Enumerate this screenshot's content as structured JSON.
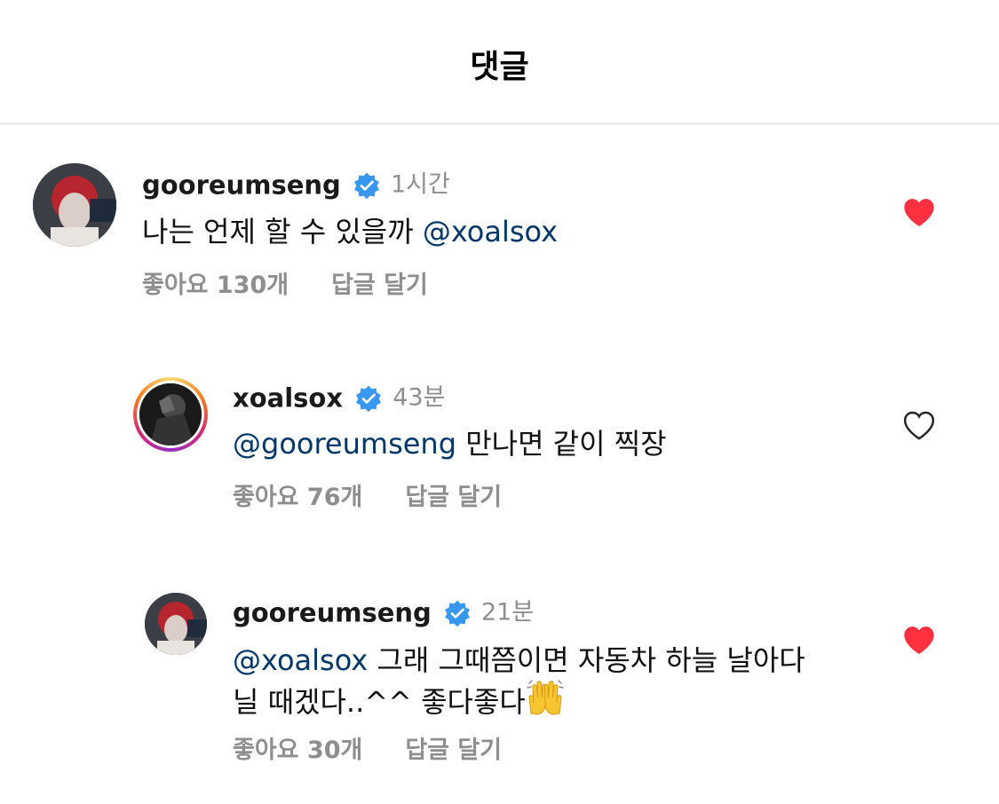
{
  "header": {
    "title": "댓글"
  },
  "comments": [
    {
      "username": "gooreumseng",
      "time": "1시간",
      "text": "나는 언제 할 수 있을까",
      "mention": "@xoalsox",
      "likes": "좋아요 130개",
      "reply": "답글 달기",
      "liked": true
    },
    {
      "username": "xoalsox",
      "time": "43분",
      "mention": "@gooreumseng",
      "text": "만나면 같이 찍장",
      "likes": "좋아요 76개",
      "reply": "답글 달기",
      "liked": false
    },
    {
      "username": "gooreumseng",
      "time": "21분",
      "mention": "@xoalsox",
      "text_line1": "그래 그때쯤이면 자동차 하늘 날아다",
      "text_line2": "닐 때겠다..^^ 좋다좋다",
      "likes": "좋아요 30개",
      "reply": "답글 달기",
      "liked": true
    }
  ],
  "colors": {
    "heart_liked": "#ff3040",
    "verified": "#3897f0",
    "mention": "#00376b",
    "secondary_text": "#8e8e8e"
  },
  "icons": {
    "verified": "verified-badge-icon",
    "heart": "heart-icon",
    "emoji": "raising-hands-emoji"
  }
}
